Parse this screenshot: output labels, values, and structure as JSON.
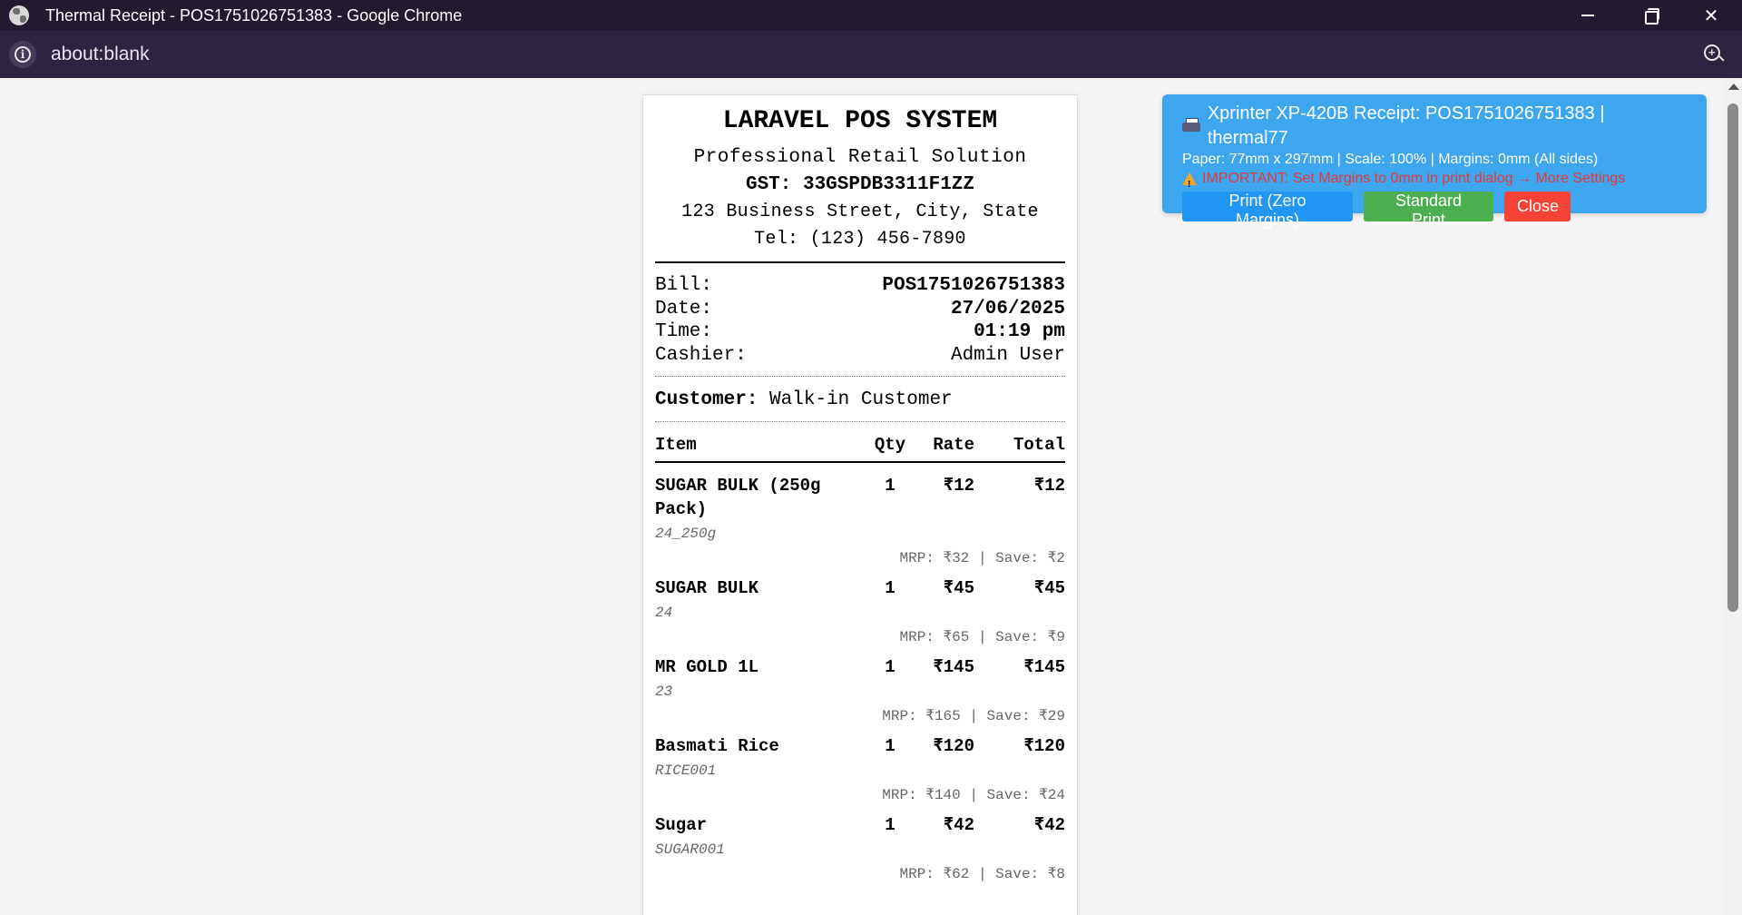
{
  "window": {
    "title": "Thermal Receipt - POS1751026751383 - Google Chrome",
    "url": "about:blank"
  },
  "receipt": {
    "store_name": "LARAVEL POS SYSTEM",
    "tagline": "Professional Retail Solution",
    "gst": "GST: 33GSPDB3311F1ZZ",
    "address": "123 Business Street, City, State",
    "tel": "Tel: (123) 456-7890",
    "meta": [
      {
        "label": "Bill:",
        "value": "POS1751026751383"
      },
      {
        "label": "Date:",
        "value": "27/06/2025"
      },
      {
        "label": "Time:",
        "value": "01:19 pm"
      },
      {
        "label": "Cashier:",
        "value": "Admin User"
      }
    ],
    "customer_label": "Customer:",
    "customer_name": "Walk-in Customer",
    "columns": {
      "item": "Item",
      "qty": "Qty",
      "rate": "Rate",
      "total": "Total"
    },
    "items": [
      {
        "name": "SUGAR BULK (250g Pack)",
        "qty": "1",
        "rate": "₹12",
        "total": "₹12",
        "code": "24_250g",
        "savings": "MRP: ₹32 | Save: ₹2"
      },
      {
        "name": "SUGAR BULK",
        "qty": "1",
        "rate": "₹45",
        "total": "₹45",
        "code": "24",
        "savings": "MRP: ₹65 | Save: ₹9"
      },
      {
        "name": "MR GOLD 1L",
        "qty": "1",
        "rate": "₹145",
        "total": "₹145",
        "code": "23",
        "savings": "MRP: ₹165 | Save: ₹29"
      },
      {
        "name": "Basmati Rice",
        "qty": "1",
        "rate": "₹120",
        "total": "₹120",
        "code": "RICE001",
        "savings": "MRP: ₹140 | Save: ₹24"
      },
      {
        "name": "Sugar",
        "qty": "1",
        "rate": "₹42",
        "total": "₹42",
        "code": "SUGAR001",
        "savings": "MRP: ₹62 | Save: ₹8"
      }
    ]
  },
  "print_panel": {
    "title": "Xprinter XP-420B Receipt: POS1751026751383 | thermal77",
    "info": "Paper: 77mm x 297mm | Scale: 100% | Margins: 0mm (All sides)",
    "warning": "IMPORTANT: Set Margins to 0mm in print dialog → More Settings",
    "btn_zero": "Print (Zero Margins)",
    "btn_standard": "Standard Print",
    "btn_close": "Close",
    "colors": {
      "panel": "#3ea5ef",
      "blue": "#2196f3",
      "green": "#4caf50",
      "red": "#f44336",
      "warning": "#e53935"
    }
  }
}
